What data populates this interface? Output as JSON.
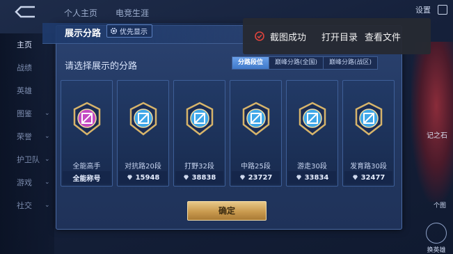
{
  "background": {
    "tabs": [
      "个人主页",
      "电竞生涯"
    ],
    "settings_label": "设置",
    "sidebar": [
      {
        "label": "主页",
        "active": true,
        "chevron": false
      },
      {
        "label": "战绩",
        "active": false,
        "chevron": false
      },
      {
        "label": "英雄",
        "active": false,
        "chevron": false
      },
      {
        "label": "图鉴",
        "active": false,
        "chevron": true
      },
      {
        "label": "荣誉",
        "active": false,
        "chevron": true
      },
      {
        "label": "护卫队",
        "active": false,
        "chevron": true
      },
      {
        "label": "游戏",
        "active": false,
        "chevron": true
      },
      {
        "label": "社交",
        "active": false,
        "chevron": true
      }
    ],
    "hero_caption": "记之石",
    "right_button_1": "个图",
    "right_button_2": "换英雄"
  },
  "modal": {
    "title": "展示分路",
    "priority_label": "优先显示",
    "subtitle": "请选择展示的分路",
    "segments": [
      {
        "label": "分路段位",
        "active": true
      },
      {
        "label": "巅峰分路(全国)",
        "active": false
      },
      {
        "label": "巅峰分路(战区)",
        "active": false
      }
    ],
    "cards": [
      {
        "name": "全能高手",
        "value": "全能称号",
        "gem": false,
        "color": "#c34ac2"
      },
      {
        "name": "对抗路20段",
        "value": "15948",
        "gem": true,
        "color": "#3fa7e8"
      },
      {
        "name": "打野32段",
        "value": "38838",
        "gem": true,
        "color": "#3fa7e8"
      },
      {
        "name": "中路25段",
        "value": "23727",
        "gem": true,
        "color": "#3fa7e8"
      },
      {
        "name": "游走30段",
        "value": "33834",
        "gem": true,
        "color": "#3fa7e8"
      },
      {
        "name": "发育路30段",
        "value": "32477",
        "gem": true,
        "color": "#3fa7e8"
      }
    ],
    "confirm_label": "确定"
  },
  "toast": {
    "message": "截图成功",
    "open_folder": "打开目录",
    "view_file": "查看文件",
    "check_color": "#e0443c"
  }
}
